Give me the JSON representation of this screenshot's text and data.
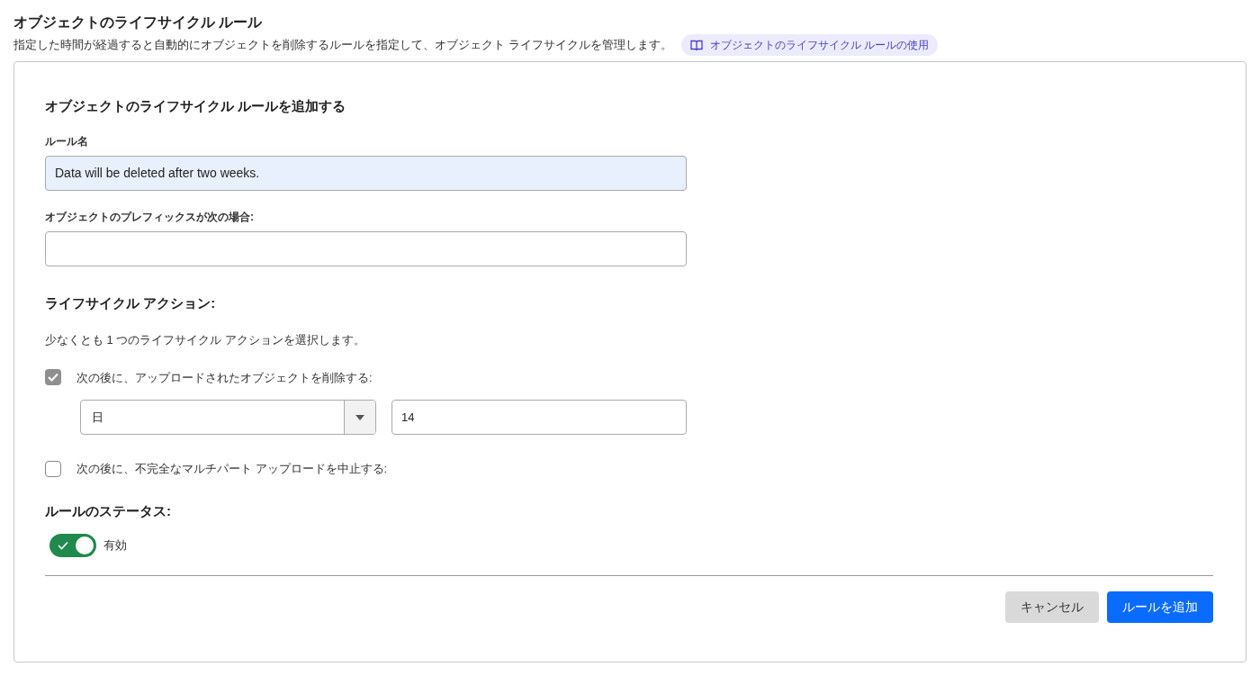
{
  "page": {
    "title": "オブジェクトのライフサイクル ルール",
    "description": "指定した時間が経過すると自動的にオブジェクトを削除するルールを指定して、オブジェクト ライフサイクルを管理します。",
    "doc_link": "オブジェクトのライフサイクル ルールの使用"
  },
  "form": {
    "heading": "オブジェクトのライフサイクル ルールを追加する",
    "rule_name": {
      "label": "ルール名",
      "value": "Data will be deleted after two weeks."
    },
    "prefix": {
      "label": "オブジェクトのプレフィックスが次の場合:"
    },
    "actions_heading": "ライフサイクル アクション:",
    "actions_help": "少なくとも 1 つのライフサイクル アクションを選択します。",
    "actions": [
      {
        "label": "次の後に、アップロードされたオブジェクトを削除する:",
        "checked": true,
        "unit": "日",
        "amount": "14"
      },
      {
        "label": "次の後に、不完全なマルチパート アップロードを中止する:",
        "checked": false
      }
    ],
    "status_heading": "ルールのステータス:",
    "status": {
      "on": true,
      "label": "有効"
    },
    "buttons": [
      {
        "label": "キャンセル",
        "kind": "secondary"
      },
      {
        "label": "ルールを追加",
        "kind": "primary"
      }
    ]
  }
}
